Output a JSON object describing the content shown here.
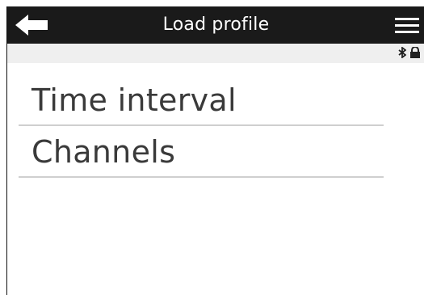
{
  "header": {
    "title": "Load profile",
    "back_icon": "arrow-left-icon",
    "menu_icon": "hamburger-menu-icon"
  },
  "status_bar": {
    "icons": [
      "bluetooth-icon",
      "lock-icon"
    ]
  },
  "list": {
    "items": [
      {
        "label": "Time interval"
      },
      {
        "label": "Channels"
      }
    ]
  },
  "colors": {
    "header_bg": "#1a1a1a",
    "header_text": "#ffffff",
    "status_bar_bg": "#efefef",
    "item_text": "#3a3a3a",
    "divider": "#cfcfcf"
  }
}
